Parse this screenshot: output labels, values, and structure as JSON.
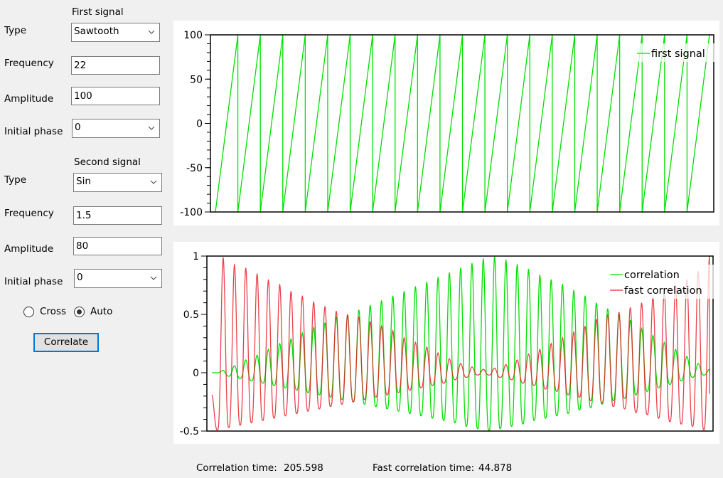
{
  "first_signal": {
    "heading": "First signal",
    "type_label": "Type",
    "type_value": "Sawtooth",
    "frequency_label": "Frequency",
    "frequency_value": "22",
    "amplitude_label": "Amplitude",
    "amplitude_value": "100",
    "phase_label": "Initial phase",
    "phase_value": "0"
  },
  "second_signal": {
    "heading": "Second signal",
    "type_label": "Type",
    "type_value": "Sin",
    "frequency_label": "Frequency",
    "frequency_value": "1.5",
    "amplitude_label": "Amplitude",
    "amplitude_value": "80",
    "phase_label": "Initial phase",
    "phase_value": "0"
  },
  "mode": {
    "options": [
      {
        "label": "Cross",
        "selected": false
      },
      {
        "label": "Auto",
        "selected": true
      }
    ]
  },
  "correlate_button": "Correlate",
  "status": {
    "correlation_time_label": "Correlation time:",
    "correlation_time_value": "205.598",
    "fast_correlation_time_label": "Fast correlation time:",
    "fast_correlation_time_value": "44.878"
  },
  "colors": {
    "green": "#00e000",
    "red": "#e8202c",
    "button_border": "#0078d7"
  },
  "chart_data": [
    {
      "type": "line",
      "title": "",
      "xlabel": "",
      "ylabel": "",
      "ylim": [
        -100,
        100
      ],
      "yticks": [
        100,
        50,
        0,
        -50,
        -100
      ],
      "ytick_labels": [
        "100",
        "50",
        "0",
        "-50",
        "-100"
      ],
      "y_minor_step": 10,
      "grid": false,
      "legend": {
        "position": "top-right",
        "entries": [
          "first signal"
        ]
      },
      "series": [
        {
          "name": "first signal",
          "color": "#00e000",
          "waveform": "sawtooth",
          "periods": 22.0,
          "amplitude": 100,
          "phase": 0
        }
      ]
    },
    {
      "type": "line",
      "title": "",
      "xlabel": "",
      "ylabel": "",
      "ylim": [
        -0.5,
        1
      ],
      "yticks": [
        1,
        0.5,
        0,
        -0.5
      ],
      "ytick_labels": [
        "1",
        "0.5",
        "0",
        "-0.5"
      ],
      "y_minor_step": 0.1,
      "grid": false,
      "legend": {
        "position": "top-right",
        "entries": [
          "correlation",
          "fast correlation"
        ]
      },
      "periods": 44,
      "series": [
        {
          "name": "correlation",
          "color": "#00e000",
          "peaks": [
            0.02,
            0.06,
            0.11,
            0.15,
            0.2,
            0.25,
            0.29,
            0.34,
            0.39,
            0.43,
            0.48,
            0.5,
            0.54,
            0.58,
            0.62,
            0.66,
            0.7,
            0.74,
            0.78,
            0.82,
            0.86,
            0.9,
            0.94,
            0.98,
            1.0,
            0.97,
            0.93,
            0.89,
            0.84,
            0.8,
            0.76,
            0.71,
            0.66,
            0.6,
            0.55,
            0.5,
            0.45,
            0.38,
            0.32,
            0.26,
            0.2,
            0.14,
            0.08,
            0.03
          ],
          "troughs": [
            0.0,
            -0.03,
            -0.05,
            -0.07,
            -0.09,
            -0.11,
            -0.13,
            -0.15,
            -0.17,
            -0.19,
            -0.21,
            -0.23,
            -0.25,
            -0.27,
            -0.29,
            -0.31,
            -0.33,
            -0.35,
            -0.37,
            -0.39,
            -0.41,
            -0.43,
            -0.46,
            -0.48,
            -0.5,
            -0.48,
            -0.46,
            -0.44,
            -0.41,
            -0.39,
            -0.37,
            -0.35,
            -0.32,
            -0.3,
            -0.27,
            -0.24,
            -0.22,
            -0.19,
            -0.16,
            -0.13,
            -0.1,
            -0.07,
            -0.04,
            -0.02
          ],
          "start": 0.0,
          "end": 0.0
        },
        {
          "name": "fast correlation",
          "color": "#e8202c",
          "peaks": [
            0.99,
            0.93,
            0.9,
            0.85,
            0.8,
            0.76,
            0.7,
            0.66,
            0.61,
            0.57,
            0.53,
            0.5,
            0.48,
            0.44,
            0.4,
            0.36,
            0.3,
            0.26,
            0.22,
            0.17,
            0.12,
            0.08,
            0.05,
            0.03,
            0.04,
            0.07,
            0.11,
            0.16,
            0.2,
            0.25,
            0.3,
            0.35,
            0.4,
            0.46,
            0.5,
            0.52,
            0.56,
            0.6,
            0.65,
            0.7,
            0.75,
            0.8,
            0.87,
            1.0
          ],
          "troughs": [
            -0.49,
            -0.47,
            -0.45,
            -0.43,
            -0.41,
            -0.39,
            -0.37,
            -0.35,
            -0.33,
            -0.31,
            -0.29,
            -0.27,
            -0.25,
            -0.23,
            -0.21,
            -0.19,
            -0.17,
            -0.15,
            -0.13,
            -0.11,
            -0.09,
            -0.06,
            -0.04,
            -0.02,
            -0.02,
            -0.04,
            -0.06,
            -0.09,
            -0.11,
            -0.14,
            -0.16,
            -0.19,
            -0.21,
            -0.24,
            -0.26,
            -0.29,
            -0.31,
            -0.34,
            -0.36,
            -0.39,
            -0.42,
            -0.44,
            -0.46,
            -0.49
          ],
          "start": -0.19,
          "end": -0.18
        }
      ]
    }
  ]
}
